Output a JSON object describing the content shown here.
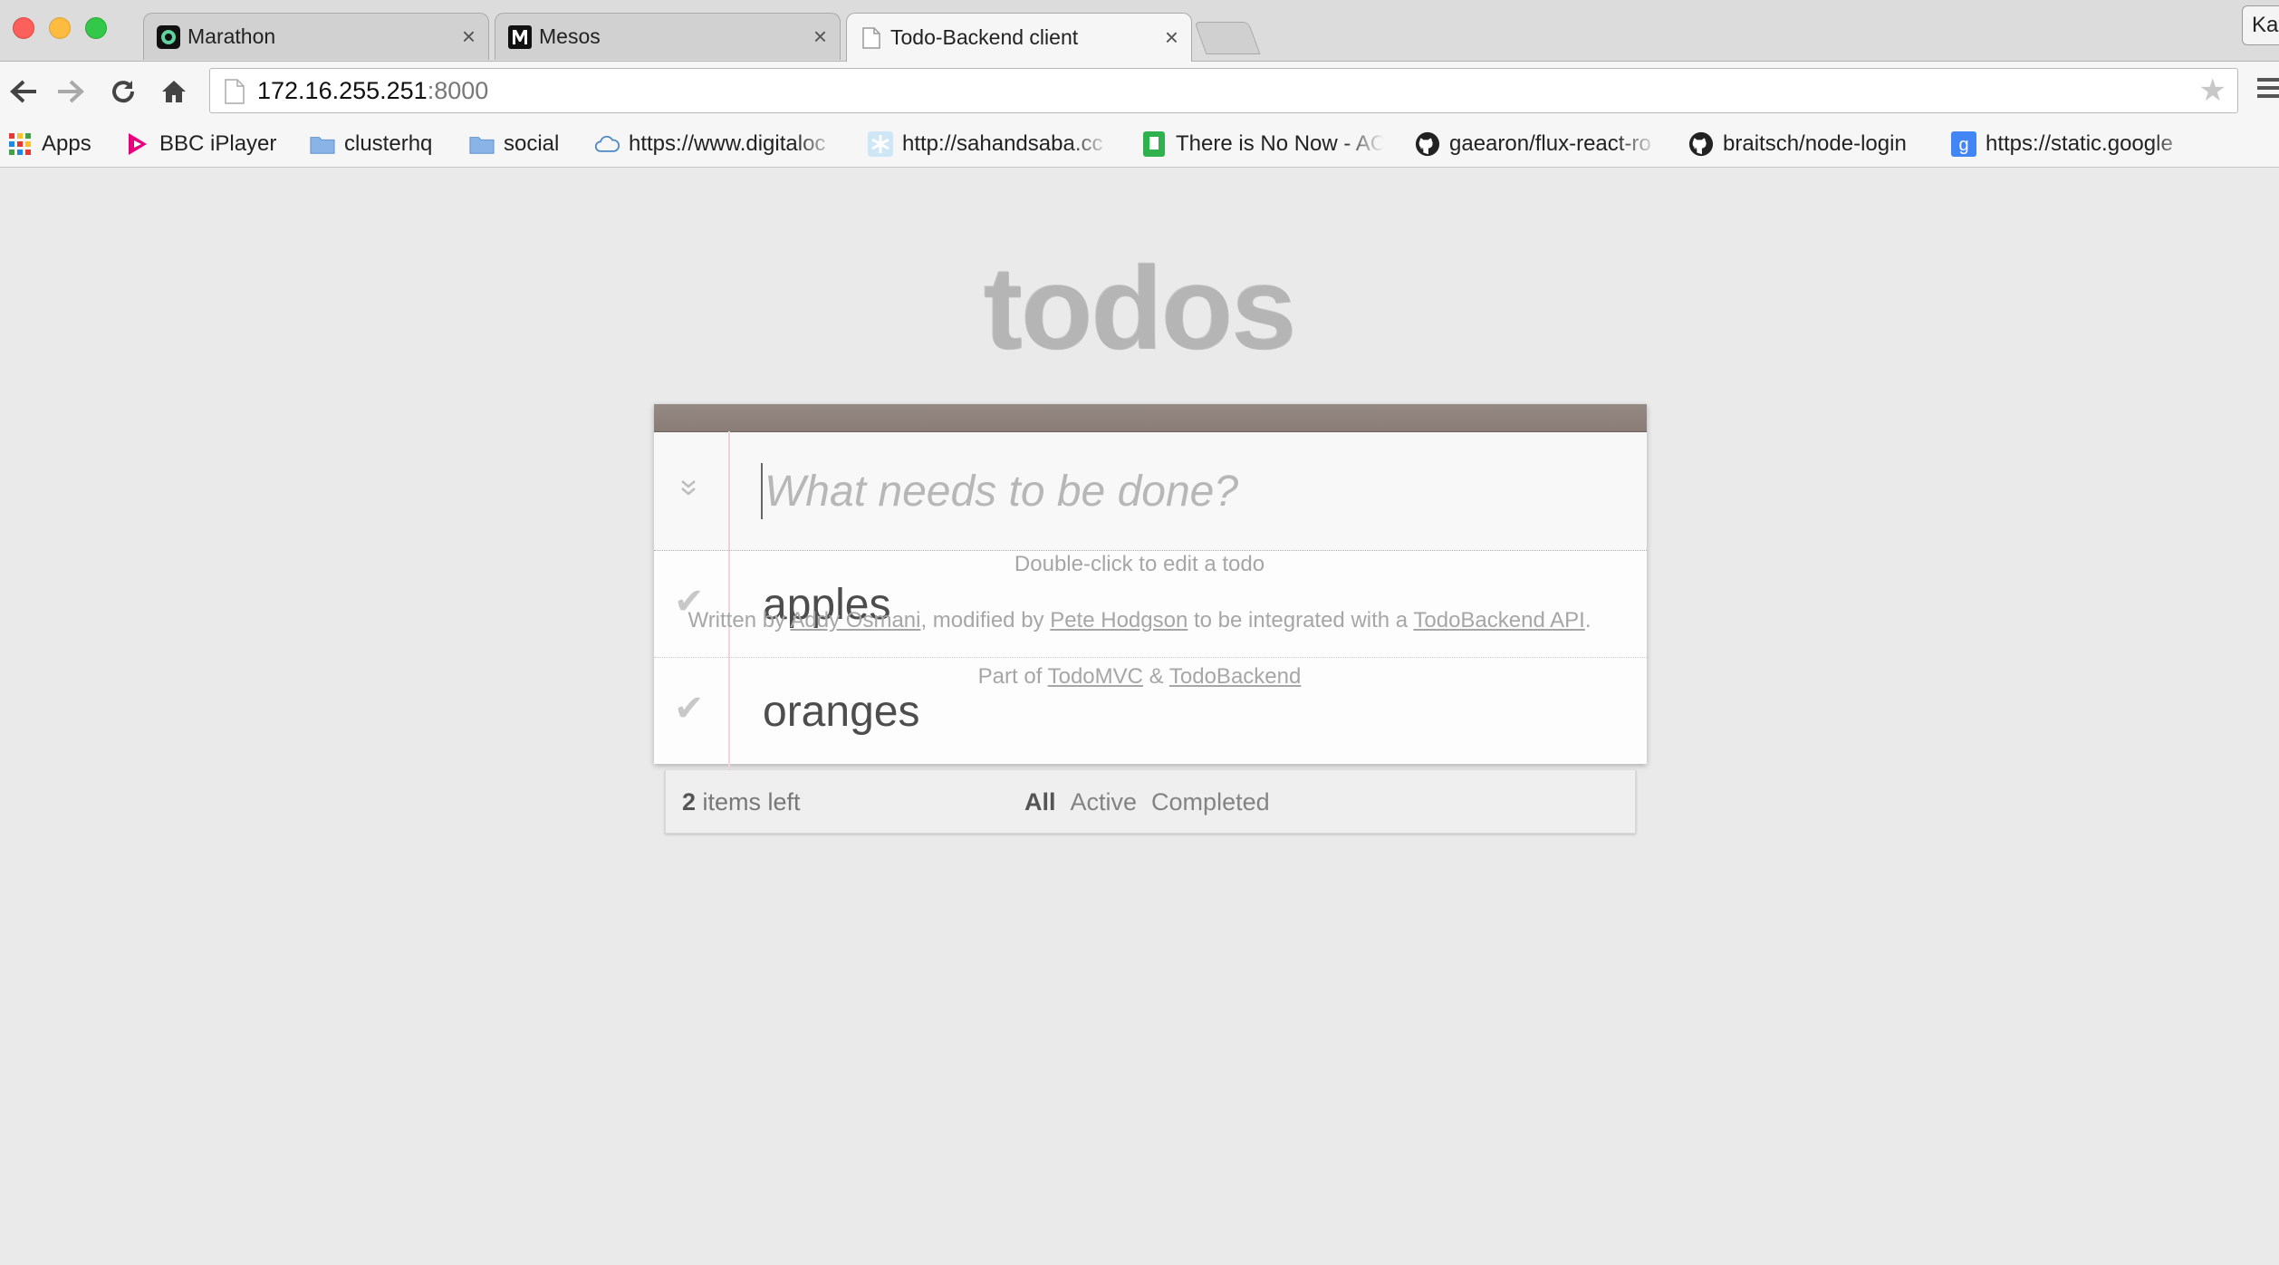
{
  "browser": {
    "tabs": [
      {
        "title": "Marathon",
        "icon": "marathon-icon"
      },
      {
        "title": "Mesos",
        "icon": "mesos-icon"
      },
      {
        "title": "Todo-Backend client",
        "icon": "page-icon"
      }
    ],
    "profile_label": "Ka",
    "address": {
      "host": "172.16.255.251",
      "port": ":8000"
    },
    "bookmarks": [
      {
        "label": "Apps",
        "icon": "apps-grid-icon"
      },
      {
        "label": "BBC iPlayer",
        "icon": "iplayer-icon"
      },
      {
        "label": "clusterhq",
        "icon": "folder-icon"
      },
      {
        "label": "social",
        "icon": "folder-icon"
      },
      {
        "label": "https://www.digitaloc",
        "icon": "cloud-icon"
      },
      {
        "label": "http://sahandsaba.cc",
        "icon": "snowflake-icon"
      },
      {
        "label": "There is No Now - AC",
        "icon": "bookmark-green-icon"
      },
      {
        "label": "gaearon/flux-react-ro",
        "icon": "github-icon"
      },
      {
        "label": "braitsch/node-login",
        "icon": "github-icon"
      },
      {
        "label": "https://static.google",
        "icon": "google-icon"
      }
    ]
  },
  "app": {
    "title": "todos",
    "new_todo_placeholder": "What needs to be done?",
    "todos": [
      {
        "title": "apples",
        "completed": false
      },
      {
        "title": "oranges",
        "completed": false
      }
    ],
    "footer": {
      "count": "2",
      "count_suffix": " items left",
      "filters": [
        "All",
        "Active",
        "Completed"
      ],
      "selected_filter": "All"
    }
  },
  "info": {
    "hint": "Double-click to edit a todo",
    "written_by_prefix": "Written by ",
    "author": "Addy Osmani",
    "modified_by_text": ", modified by ",
    "modifier": "Pete Hodgson",
    "integrated_text": " to be integrated with a ",
    "api_link": "TodoBackend API",
    "period": ".",
    "part_of_prefix": "Part of ",
    "todomvc_link": "TodoMVC",
    "ampersand": " & ",
    "todobackend_link": "TodoBackend"
  }
}
